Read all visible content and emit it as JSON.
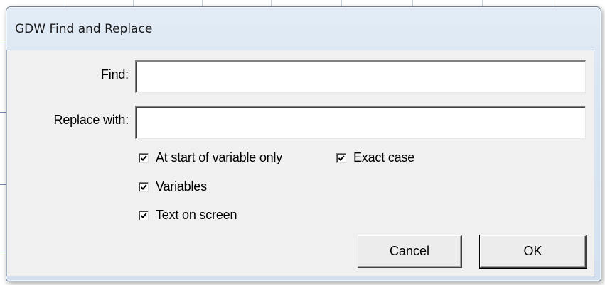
{
  "window": {
    "title": "GDW Find and Replace"
  },
  "form": {
    "find_label": "Find:",
    "find_value": "",
    "replace_label": "Replace with:",
    "replace_value": ""
  },
  "options": {
    "start_of_variable": {
      "label": "At start of variable only",
      "checked": true
    },
    "exact_case": {
      "label": "Exact case",
      "checked": true
    },
    "variables": {
      "label": "Variables",
      "checked": true
    },
    "text_on_screen": {
      "label": "Text on screen",
      "checked": true
    }
  },
  "buttons": {
    "cancel_label": "Cancel",
    "ok_label": "OK"
  }
}
